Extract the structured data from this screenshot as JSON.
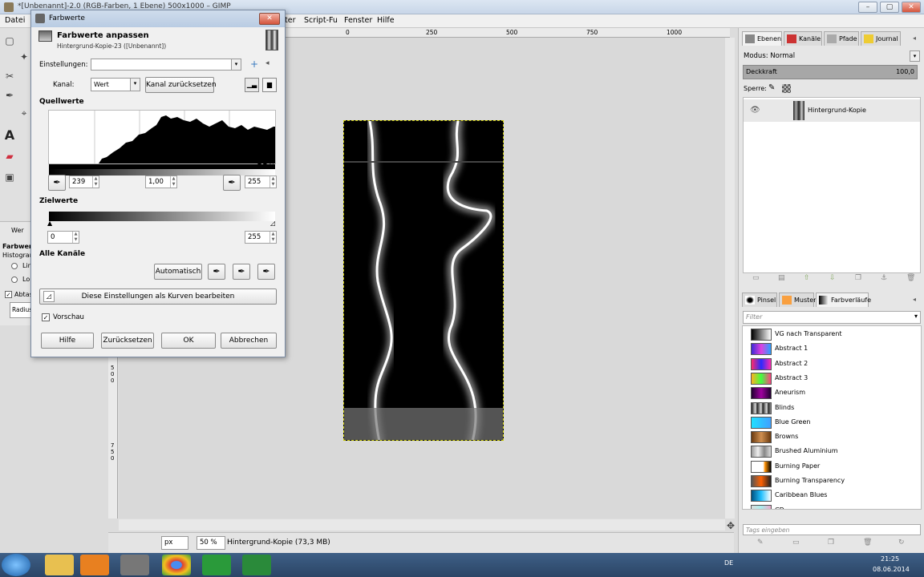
{
  "window": {
    "title": "*[Unbenannt]-2.0 (RGB-Farben, 1 Ebene) 500x1000 – GIMP",
    "min": "–",
    "max": "▢",
    "close": "✕"
  },
  "menubar": {
    "items": [
      "Datei",
      "ter",
      "Script-Fu",
      "Fenster",
      "Hilfe"
    ]
  },
  "ruler": {
    "top": [
      "0",
      "250",
      "500",
      "750",
      "1000"
    ],
    "left": [
      "5",
      "0",
      "0",
      "7",
      "5",
      "0",
      "1",
      "0",
      "0",
      "0"
    ]
  },
  "toolopts": {
    "tab": "Wer",
    "title": "Farbwerte",
    "subtitle": "Histogram",
    "radio1": "Lin",
    "radio2": "Lo",
    "check": "Abtas",
    "radius": "Radius"
  },
  "dialog": {
    "title": "Farbwerte",
    "heading": "Farbwerte anpassen",
    "subheading": "Hintergrund-Kopie-23 ([Unbenannt])",
    "settings_label": "Einstellungen:",
    "settings_value": "",
    "channel_label": "Kanal:",
    "channel_value": "Wert",
    "reset_channel": "Kanal zurücksetzen",
    "source_header": "Quellwerte",
    "in_low": "239",
    "gamma": "1,00",
    "in_high": "255",
    "target_header": "Zielwerte",
    "out_low": "0",
    "out_high": "255",
    "all_channels": "Alle Kanäle",
    "auto": "Automatisch",
    "curves": "Diese Einstellungen als Kurven bearbeiten",
    "preview": "Vorschau",
    "help": "Hilfe",
    "reset": "Zurücksetzen",
    "ok": "OK",
    "cancel": "Abbrechen"
  },
  "status": {
    "unit": "px",
    "zoom": "50 %",
    "info": "Hintergrund-Kopie (73,3 MB)"
  },
  "layers": {
    "tabs": [
      "Ebenen",
      "Kanäle",
      "Pfade",
      "Journal"
    ],
    "mode_label": "Modus: Normal",
    "opacity_label": "Deckkraft",
    "opacity_value": "100,0",
    "lock_label": "Sperre:",
    "layer_name": "Hintergrund-Kopie"
  },
  "brushes": {
    "tabs": [
      "Pinsel",
      "Muster",
      "Farbverläufe"
    ],
    "filter_placeholder": "Filter",
    "tags_placeholder": "Tags eingeben",
    "gradients": [
      {
        "name": "VG nach Transparent",
        "c": "linear-gradient(90deg,#000,rgba(0,0,0,0))"
      },
      {
        "name": "Abstract 1",
        "c": "linear-gradient(90deg,#3b2bd6,#e040e0,#2aa0ff)"
      },
      {
        "name": "Abstract 2",
        "c": "linear-gradient(90deg,#ff2a6a,#2a2aff,#ff2ab0)"
      },
      {
        "name": "Abstract 3",
        "c": "linear-gradient(90deg,#ffb020,#40ff40,#ff4080)"
      },
      {
        "name": "Aneurism",
        "c": "linear-gradient(90deg,#200030,#a000a0,#200030)"
      },
      {
        "name": "Blinds",
        "c": "repeating-linear-gradient(90deg,#222 0,#ddd 5px,#222 7px)"
      },
      {
        "name": "Blue Green",
        "c": "linear-gradient(90deg,#20e0ff,#40a0ff)"
      },
      {
        "name": "Browns",
        "c": "linear-gradient(90deg,#6a3a10,#d09050,#6a3a10)"
      },
      {
        "name": "Brushed Aluminium",
        "c": "linear-gradient(90deg,#999,#eee,#888,#ddd)"
      },
      {
        "name": "Burning Paper",
        "c": "linear-gradient(90deg,#fff 60%,#ff9000 70%,#000)"
      },
      {
        "name": "Burning Transparency",
        "c": "linear-gradient(90deg,#555,#ff6000,#222)"
      },
      {
        "name": "Caribbean Blues",
        "c": "linear-gradient(90deg,#005080,#20c0ff,#fff)"
      },
      {
        "name": "CD",
        "c": "linear-gradient(90deg,#ddd,#aee,#eac)"
      }
    ]
  },
  "taskbar": {
    "lang": "DE",
    "time": "21:25",
    "date": "08.06.2014"
  }
}
